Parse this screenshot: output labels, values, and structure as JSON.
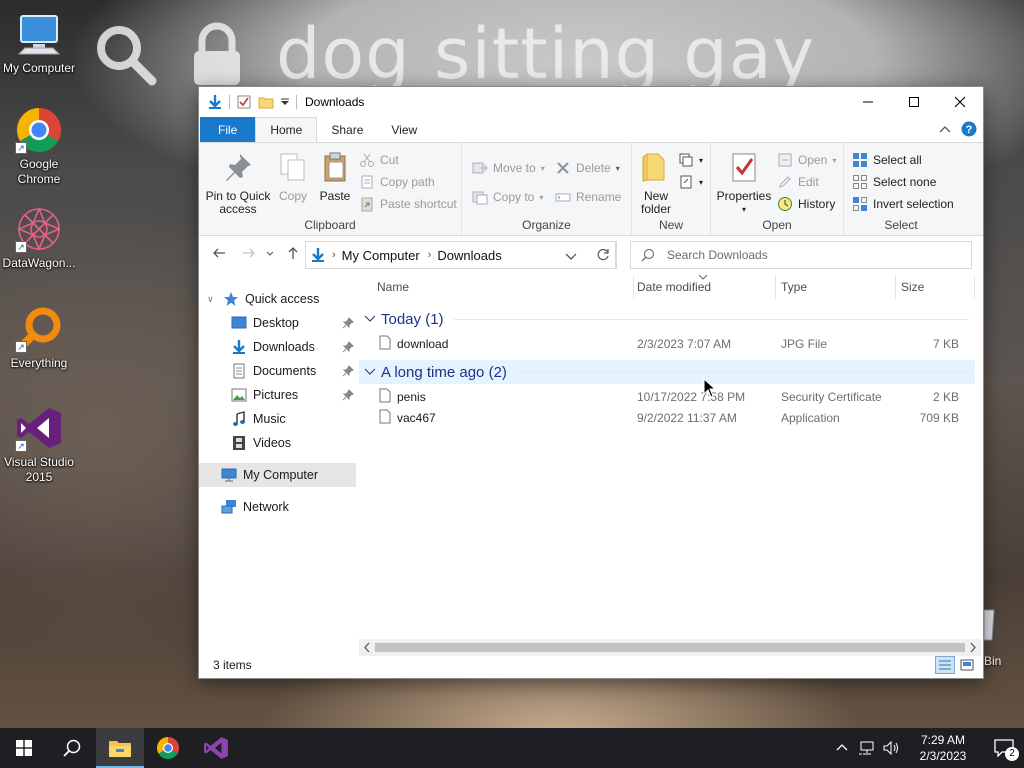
{
  "wallpaper": {
    "search_text": "dog sitting gay"
  },
  "desktop_icons": [
    {
      "label": "My Computer",
      "icon": "computer-icon"
    },
    {
      "label": "Google Chrome",
      "icon": "chrome-icon"
    },
    {
      "label": "DataWagon...",
      "icon": "datawagon-icon"
    },
    {
      "label": "Everything",
      "icon": "everything-search-icon"
    },
    {
      "label": "Visual Studio 2015",
      "icon": "visual-studio-icon"
    },
    {
      "label": "Bin",
      "icon": "recycle-bin-icon"
    }
  ],
  "window": {
    "title": "Downloads",
    "tabs": {
      "file": "File",
      "home": "Home",
      "share": "Share",
      "view": "View"
    },
    "ribbon": {
      "clipboard": {
        "name": "Clipboard",
        "pin": "Pin to Quick access",
        "copy": "Copy",
        "paste": "Paste",
        "cut": "Cut",
        "copy_path": "Copy path",
        "paste_shortcut": "Paste shortcut"
      },
      "organize": {
        "name": "Organize",
        "move_to": "Move to",
        "copy_to": "Copy to",
        "delete": "Delete",
        "rename": "Rename"
      },
      "new": {
        "name": "New",
        "new_folder": "New folder"
      },
      "open": {
        "name": "Open",
        "properties": "Properties",
        "open": "Open",
        "edit": "Edit",
        "history": "History"
      },
      "select": {
        "name": "Select",
        "select_all": "Select all",
        "select_none": "Select none",
        "invert": "Invert selection"
      }
    },
    "address": {
      "root": "My Computer",
      "current": "Downloads"
    },
    "search_placeholder": "Search Downloads",
    "nav": {
      "quick_access": "Quick access",
      "desktop": "Desktop",
      "downloads": "Downloads",
      "documents": "Documents",
      "pictures": "Pictures",
      "music": "Music",
      "videos": "Videos",
      "my_computer": "My Computer",
      "network": "Network"
    },
    "columns": {
      "name": "Name",
      "date": "Date modified",
      "type": "Type",
      "size": "Size"
    },
    "groups": [
      {
        "label": "Today (1)",
        "files": [
          {
            "name": "download",
            "date": "2/3/2023 7:07 AM",
            "type": "JPG File",
            "size": "7 KB"
          }
        ]
      },
      {
        "label": "A long time ago (2)",
        "files": [
          {
            "name": "penis",
            "date": "10/17/2022 7:58 PM",
            "type": "Security Certificate",
            "size": "2 KB"
          },
          {
            "name": "vac467",
            "date": "9/2/2022 11:37 AM",
            "type": "Application",
            "size": "709 KB"
          }
        ]
      }
    ],
    "status": "3 items"
  },
  "taskbar": {
    "time": "7:29 AM",
    "date": "2/3/2023",
    "notifications": "2"
  },
  "colors": {
    "accent": "#1979ca",
    "group_header": "#1e3287",
    "taskbar": "#1d1f22"
  }
}
